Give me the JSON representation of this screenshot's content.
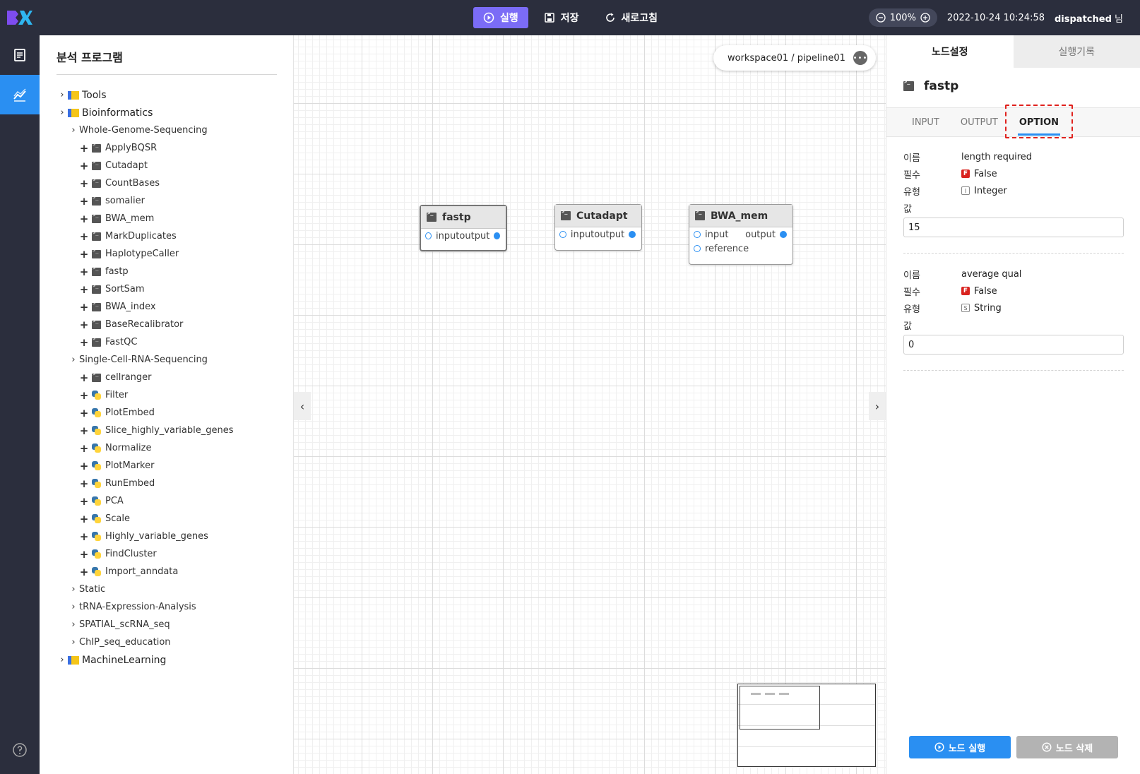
{
  "topbar": {
    "run_label": "실행",
    "save_label": "저장",
    "refresh_label": "새로고침",
    "zoom": "100%",
    "datetime": "2022-10-24 10:24:58",
    "user": "dispatched",
    "user_suffix": "님"
  },
  "sidebar": {
    "title": "분석 프로그램",
    "tree": [
      {
        "label": "Tools",
        "level": 0,
        "kind": "folder"
      },
      {
        "label": "Bioinformatics",
        "level": 0,
        "kind": "folder"
      },
      {
        "label": "Whole-Genome-Sequencing",
        "level": 1,
        "kind": "group"
      },
      {
        "label": "ApplyBQSR",
        "level": 2,
        "kind": "terminal"
      },
      {
        "label": "Cutadapt",
        "level": 2,
        "kind": "terminal"
      },
      {
        "label": "CountBases",
        "level": 2,
        "kind": "terminal"
      },
      {
        "label": "somalier",
        "level": 2,
        "kind": "terminal"
      },
      {
        "label": "BWA_mem",
        "level": 2,
        "kind": "terminal"
      },
      {
        "label": "MarkDuplicates",
        "level": 2,
        "kind": "terminal"
      },
      {
        "label": "HaplotypeCaller",
        "level": 2,
        "kind": "terminal"
      },
      {
        "label": "fastp",
        "level": 2,
        "kind": "terminal"
      },
      {
        "label": "SortSam",
        "level": 2,
        "kind": "terminal"
      },
      {
        "label": "BWA_index",
        "level": 2,
        "kind": "terminal"
      },
      {
        "label": "BaseRecalibrator",
        "level": 2,
        "kind": "terminal"
      },
      {
        "label": "FastQC",
        "level": 2,
        "kind": "terminal"
      },
      {
        "label": "Single-Cell-RNA-Sequencing",
        "level": 1,
        "kind": "group"
      },
      {
        "label": "cellranger",
        "level": 2,
        "kind": "terminal"
      },
      {
        "label": "Filter",
        "level": 2,
        "kind": "python"
      },
      {
        "label": "PlotEmbed",
        "level": 2,
        "kind": "python"
      },
      {
        "label": "Slice_highly_variable_genes",
        "level": 2,
        "kind": "python"
      },
      {
        "label": "Normalize",
        "level": 2,
        "kind": "python"
      },
      {
        "label": "PlotMarker",
        "level": 2,
        "kind": "python"
      },
      {
        "label": "RunEmbed",
        "level": 2,
        "kind": "python"
      },
      {
        "label": "PCA",
        "level": 2,
        "kind": "python"
      },
      {
        "label": "Scale",
        "level": 2,
        "kind": "python"
      },
      {
        "label": "Highly_variable_genes",
        "level": 2,
        "kind": "python"
      },
      {
        "label": "FindCluster",
        "level": 2,
        "kind": "python"
      },
      {
        "label": "Import_anndata",
        "level": 2,
        "kind": "python"
      },
      {
        "label": "Static",
        "level": 1,
        "kind": "group"
      },
      {
        "label": "tRNA-Expression-Analysis",
        "level": 1,
        "kind": "group"
      },
      {
        "label": "SPATIAL_scRNA_seq",
        "level": 1,
        "kind": "group"
      },
      {
        "label": "ChIP_seq_education",
        "level": 1,
        "kind": "group"
      },
      {
        "label": "MachineLearning",
        "level": 0,
        "kind": "folder"
      }
    ]
  },
  "canvas": {
    "path": "workspace01 / pipeline01",
    "more": "•••",
    "nodes": [
      {
        "title": "fastp",
        "in": "input",
        "out": "output"
      },
      {
        "title": "Cutadapt",
        "in": "input",
        "out": "output"
      },
      {
        "title": "BWA_mem",
        "in": "input",
        "out": "output",
        "extra": "reference"
      }
    ],
    "left_arrow": "‹",
    "right_arrow": "›"
  },
  "panel": {
    "tabs": [
      "노드설정",
      "실행기록"
    ],
    "node_title": "fastp",
    "subtabs": [
      "INPUT",
      "OUTPUT",
      "OPTION"
    ],
    "labels": {
      "name": "이름",
      "required": "필수",
      "type": "유형",
      "value": "값"
    },
    "options": [
      {
        "name": "length required",
        "required": "False",
        "required_badge": "F",
        "type": "Integer",
        "type_badge": "I",
        "value": "15"
      },
      {
        "name": "average qual",
        "required": "False",
        "required_badge": "F",
        "type": "String",
        "type_badge": "S",
        "value": "0"
      }
    ],
    "run_node": "노드 실행",
    "delete_node": "노드 삭제"
  }
}
